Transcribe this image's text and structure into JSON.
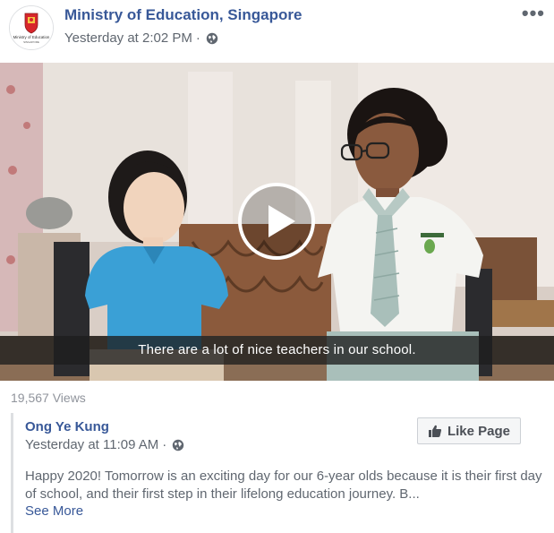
{
  "post": {
    "page_name": "Ministry of Education, Singapore",
    "timestamp": "Yesterday at 2:02 PM",
    "separator": "·",
    "privacy_icon": "globe-icon",
    "more_icon": "more-options-icon",
    "more_label": "•••",
    "logo_text": "Ministry of Education",
    "logo_subtext": "SINGAPORE"
  },
  "video": {
    "caption": "There are a lot of nice teachers in our school.",
    "play_icon": "play-icon"
  },
  "stats": {
    "views": "19,567 Views"
  },
  "shared": {
    "author": "Ong Ye Kung",
    "timestamp": "Yesterday at 11:09 AM",
    "separator": "·",
    "like_page_label": "Like Page",
    "text": "Happy 2020! Tomorrow is an exciting day for our 6-year olds because it is their first day of school, and their first step in their lifelong education journey. B...",
    "see_more": "See More"
  },
  "colors": {
    "link": "#385898",
    "meta": "#606770",
    "views": "#90949c"
  }
}
